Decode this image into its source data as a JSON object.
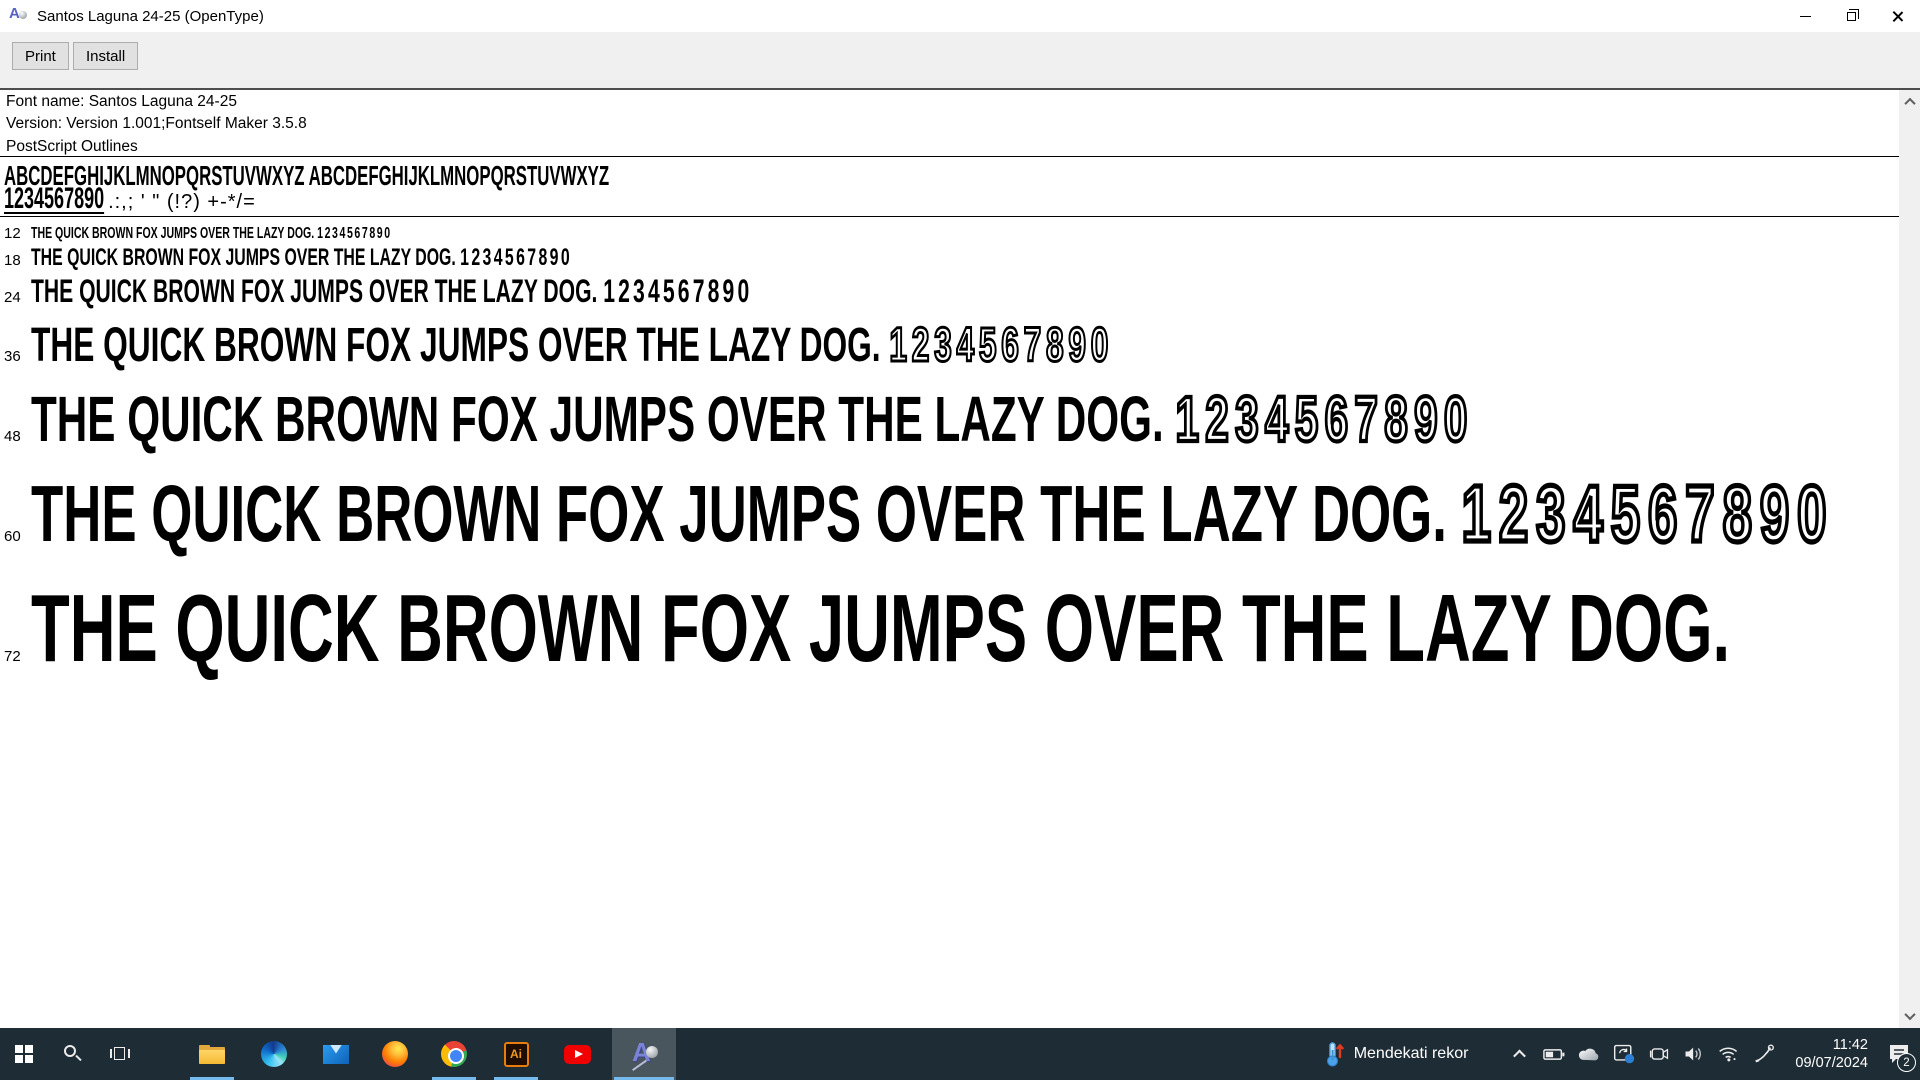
{
  "window": {
    "title": "Santos Laguna 24-25 (OpenType)",
    "app_icon_glyph": "A",
    "toolbar": {
      "print": "Print",
      "install": "Install"
    },
    "info": {
      "line1": "Font name: Santos Laguna 24-25",
      "line2": "Version: Version 1.001;Fontself Maker 3.5.8",
      "line3": "PostScript Outlines"
    },
    "glyphs": {
      "alphabet": "ABCDEFGHIJKLMNOPQRSTUVWXYZ ABCDEFGHIJKLMNOPQRSTUVWXYZ",
      "digits": "1234567890",
      "punct": ".:,; ' \" (!?) +-*/="
    },
    "samples": {
      "sentence": "THE QUICK BROWN FOX JUMPS OVER THE LAZY DOG. ",
      "rows": [
        {
          "size": "12",
          "digits": "1234567890"
        },
        {
          "size": "18",
          "digits": "1234567890"
        },
        {
          "size": "24",
          "digits": "1234567890"
        },
        {
          "size": "36",
          "digits": "1234567890"
        },
        {
          "size": "48",
          "digits": "1234567890"
        },
        {
          "size": "60",
          "digits": "1234567890"
        },
        {
          "size": "72",
          "digits": ""
        }
      ]
    }
  },
  "taskbar": {
    "fontview_glyph": "A",
    "illustrator_glyph": "Ai",
    "widget": {
      "label": "Mendekati rekor"
    },
    "tray": {
      "time": "11:42",
      "date": "09/07/2024",
      "badge": "2"
    }
  },
  "colors": {
    "accent_underline": "#76b9ed",
    "taskbar_bg": "#1e2c35"
  }
}
